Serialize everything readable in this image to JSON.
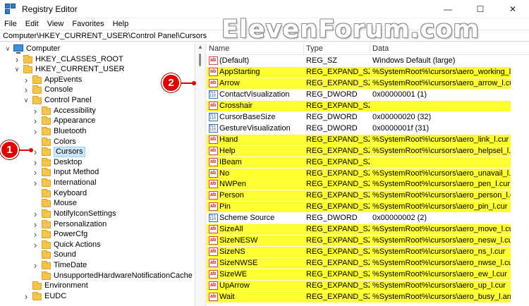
{
  "window": {
    "title": "Registry Editor",
    "watermark": "ElevenForum.com"
  },
  "menu": [
    "File",
    "Edit",
    "View",
    "Favorites",
    "Help"
  ],
  "address": "Computer\\HKEY_CURRENT_USER\\Control Panel\\Cursors",
  "tree": [
    {
      "label": "Computer",
      "icon": "computer-icon",
      "chevron": "down"
    },
    {
      "label": "HKEY_CLASSES_ROOT",
      "icon": "folder-icon",
      "chevron": "right"
    },
    {
      "label": "HKEY_CURRENT_USER",
      "icon": "folder-icon",
      "chevron": "down"
    },
    {
      "label": "AppEvents",
      "icon": "folder-icon",
      "chevron": "right"
    },
    {
      "label": "Console",
      "icon": "folder-icon",
      "chevron": "right"
    },
    {
      "label": "Control Panel",
      "icon": "folder-icon",
      "chevron": "down"
    },
    {
      "label": "Accessibility",
      "icon": "folder-icon",
      "chevron": "right"
    },
    {
      "label": "Appearance",
      "icon": "folder-icon",
      "chevron": "right"
    },
    {
      "label": "Bluetooth",
      "icon": "folder-icon",
      "chevron": "right"
    },
    {
      "label": "Colors",
      "icon": "folder-icon",
      "chevron": ""
    },
    {
      "label": "Cursors",
      "icon": "folder-icon",
      "chevron": "right",
      "selected": true
    },
    {
      "label": "Desktop",
      "icon": "folder-icon",
      "chevron": "right"
    },
    {
      "label": "Input Method",
      "icon": "folder-icon",
      "chevron": "right"
    },
    {
      "label": "International",
      "icon": "folder-icon",
      "chevron": "right"
    },
    {
      "label": "Keyboard",
      "icon": "folder-icon",
      "chevron": ""
    },
    {
      "label": "Mouse",
      "icon": "folder-icon",
      "chevron": ""
    },
    {
      "label": "NotifyIconSettings",
      "icon": "folder-icon",
      "chevron": "right"
    },
    {
      "label": "Personalization",
      "icon": "folder-icon",
      "chevron": "right"
    },
    {
      "label": "PowerCfg",
      "icon": "folder-icon",
      "chevron": "right"
    },
    {
      "label": "Quick Actions",
      "icon": "folder-icon",
      "chevron": "right"
    },
    {
      "label": "Sound",
      "icon": "folder-icon",
      "chevron": ""
    },
    {
      "label": "TimeDate",
      "icon": "folder-icon",
      "chevron": "right"
    },
    {
      "label": "UnsupportedHardwareNotificationCache",
      "icon": "folder-icon",
      "chevron": ""
    },
    {
      "label": "Environment",
      "icon": "folder-icon",
      "chevron": ""
    },
    {
      "label": "EUDC",
      "icon": "folder-icon",
      "chevron": "right"
    }
  ],
  "columns": {
    "name": "Name",
    "type": "Type",
    "data": "Data"
  },
  "values": [
    {
      "name": "(Default)",
      "type": "REG_SZ",
      "data": "Windows Default (large)",
      "icon": "string-value-icon",
      "highlight": false
    },
    {
      "name": "AppStarting",
      "type": "REG_EXPAND_SZ",
      "data": "%SystemRoot%\\cursors\\aero_working_l.ani",
      "icon": "string-value-icon",
      "highlight": true
    },
    {
      "name": "Arrow",
      "type": "REG_EXPAND_SZ",
      "data": "%SystemRoot%\\cursors\\aero_arrow_l.cur",
      "icon": "string-value-icon",
      "highlight": true
    },
    {
      "name": "ContactVisualization",
      "type": "REG_DWORD",
      "data": "0x00000001 (1)",
      "icon": "dword-value-icon",
      "highlight": false
    },
    {
      "name": "Crosshair",
      "type": "REG_EXPAND_SZ",
      "data": "",
      "icon": "string-value-icon",
      "highlight": true
    },
    {
      "name": "CursorBaseSize",
      "type": "REG_DWORD",
      "data": "0x00000020 (32)",
      "icon": "dword-value-icon",
      "highlight": false
    },
    {
      "name": "GestureVisualization",
      "type": "REG_DWORD",
      "data": "0x0000001f (31)",
      "icon": "dword-value-icon",
      "highlight": false
    },
    {
      "name": "Hand",
      "type": "REG_EXPAND_SZ",
      "data": "%SystemRoot%\\cursors\\aero_link_l.cur",
      "icon": "string-value-icon",
      "highlight": true
    },
    {
      "name": "Help",
      "type": "REG_EXPAND_SZ",
      "data": "%SystemRoot%\\cursors\\aero_helpsel_l.cur",
      "icon": "string-value-icon",
      "highlight": true
    },
    {
      "name": "IBeam",
      "type": "REG_EXPAND_SZ",
      "data": "",
      "icon": "string-value-icon",
      "highlight": true
    },
    {
      "name": "No",
      "type": "REG_EXPAND_SZ",
      "data": "%SystemRoot%\\cursors\\aero_unavail_l.cur",
      "icon": "string-value-icon",
      "highlight": true
    },
    {
      "name": "NWPen",
      "type": "REG_EXPAND_SZ",
      "data": "%SystemRoot%\\cursors\\aero_pen_l.cur",
      "icon": "string-value-icon",
      "highlight": true
    },
    {
      "name": "Person",
      "type": "REG_EXPAND_SZ",
      "data": "%SystemRoot%\\cursors\\aero_person_l.cur",
      "icon": "string-value-icon",
      "highlight": true
    },
    {
      "name": "Pin",
      "type": "REG_EXPAND_SZ",
      "data": "%SystemRoot%\\cursors\\aero_pin_l.cur",
      "icon": "string-value-icon",
      "highlight": true
    },
    {
      "name": "Scheme Source",
      "type": "REG_DWORD",
      "data": "0x00000002 (2)",
      "icon": "dword-value-icon",
      "highlight": false
    },
    {
      "name": "SizeAll",
      "type": "REG_EXPAND_SZ",
      "data": "%SystemRoot%\\cursors\\aero_move_l.cur",
      "icon": "string-value-icon",
      "highlight": true
    },
    {
      "name": "SizeNESW",
      "type": "REG_EXPAND_SZ",
      "data": "%SystemRoot%\\cursors\\aero_nesw_l.cur",
      "icon": "string-value-icon",
      "highlight": true
    },
    {
      "name": "SizeNS",
      "type": "REG_EXPAND_SZ",
      "data": "%SystemRoot%\\cursors\\aero_ns_l.cur",
      "icon": "string-value-icon",
      "highlight": true
    },
    {
      "name": "SizeNWSE",
      "type": "REG_EXPAND_SZ",
      "data": "%SystemRoot%\\cursors\\aero_nwse_l.cur",
      "icon": "string-value-icon",
      "highlight": true
    },
    {
      "name": "SizeWE",
      "type": "REG_EXPAND_SZ",
      "data": "%SystemRoot%\\cursors\\aero_ew_l.cur",
      "icon": "string-value-icon",
      "highlight": true
    },
    {
      "name": "UpArrow",
      "type": "REG_EXPAND_SZ",
      "data": "%SystemRoot%\\cursors\\aero_up_l.cur",
      "icon": "string-value-icon",
      "highlight": true
    },
    {
      "name": "Wait",
      "type": "REG_EXPAND_SZ",
      "data": "%SystemRoot%\\cursors\\aero_busy_l.ani",
      "icon": "string-value-icon",
      "highlight": true
    }
  ],
  "callouts": [
    "1",
    "2"
  ],
  "colors": {
    "highlight": "#ffff33",
    "callout": "#e00000",
    "selection": "#cce8ff"
  }
}
